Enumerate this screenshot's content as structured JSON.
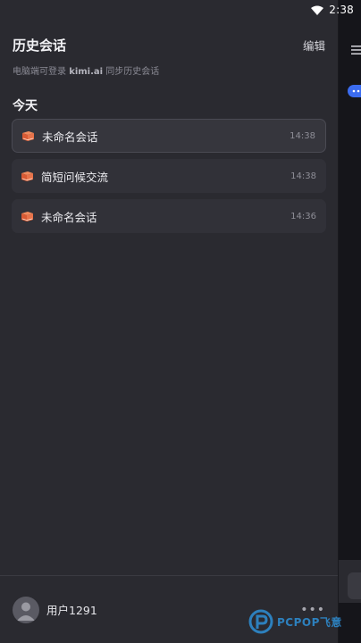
{
  "status_bar": {
    "time": "2:38"
  },
  "drawer": {
    "title": "历史会话",
    "edit_label": "编辑",
    "sync_hint_prefix": "电脑端可登录 ",
    "sync_hint_site": "kimi.ai",
    "sync_hint_suffix": " 同步历史会话",
    "section_label": "今天",
    "sessions": [
      {
        "title": "未命名会话",
        "time": "14:38",
        "icon": "book-icon"
      },
      {
        "title": "简短问候交流",
        "time": "14:38",
        "icon": "book-icon"
      },
      {
        "title": "未命名会话",
        "time": "14:36",
        "icon": "book-icon"
      }
    ]
  },
  "footer": {
    "username": "用户1291",
    "more_label": "•••"
  },
  "watermark": {
    "text": "PCPOP飞意"
  },
  "colors": {
    "drawer_bg": "#2a2a30",
    "accent_blue": "#3b6cf0",
    "book_orange": "#e8734a"
  }
}
